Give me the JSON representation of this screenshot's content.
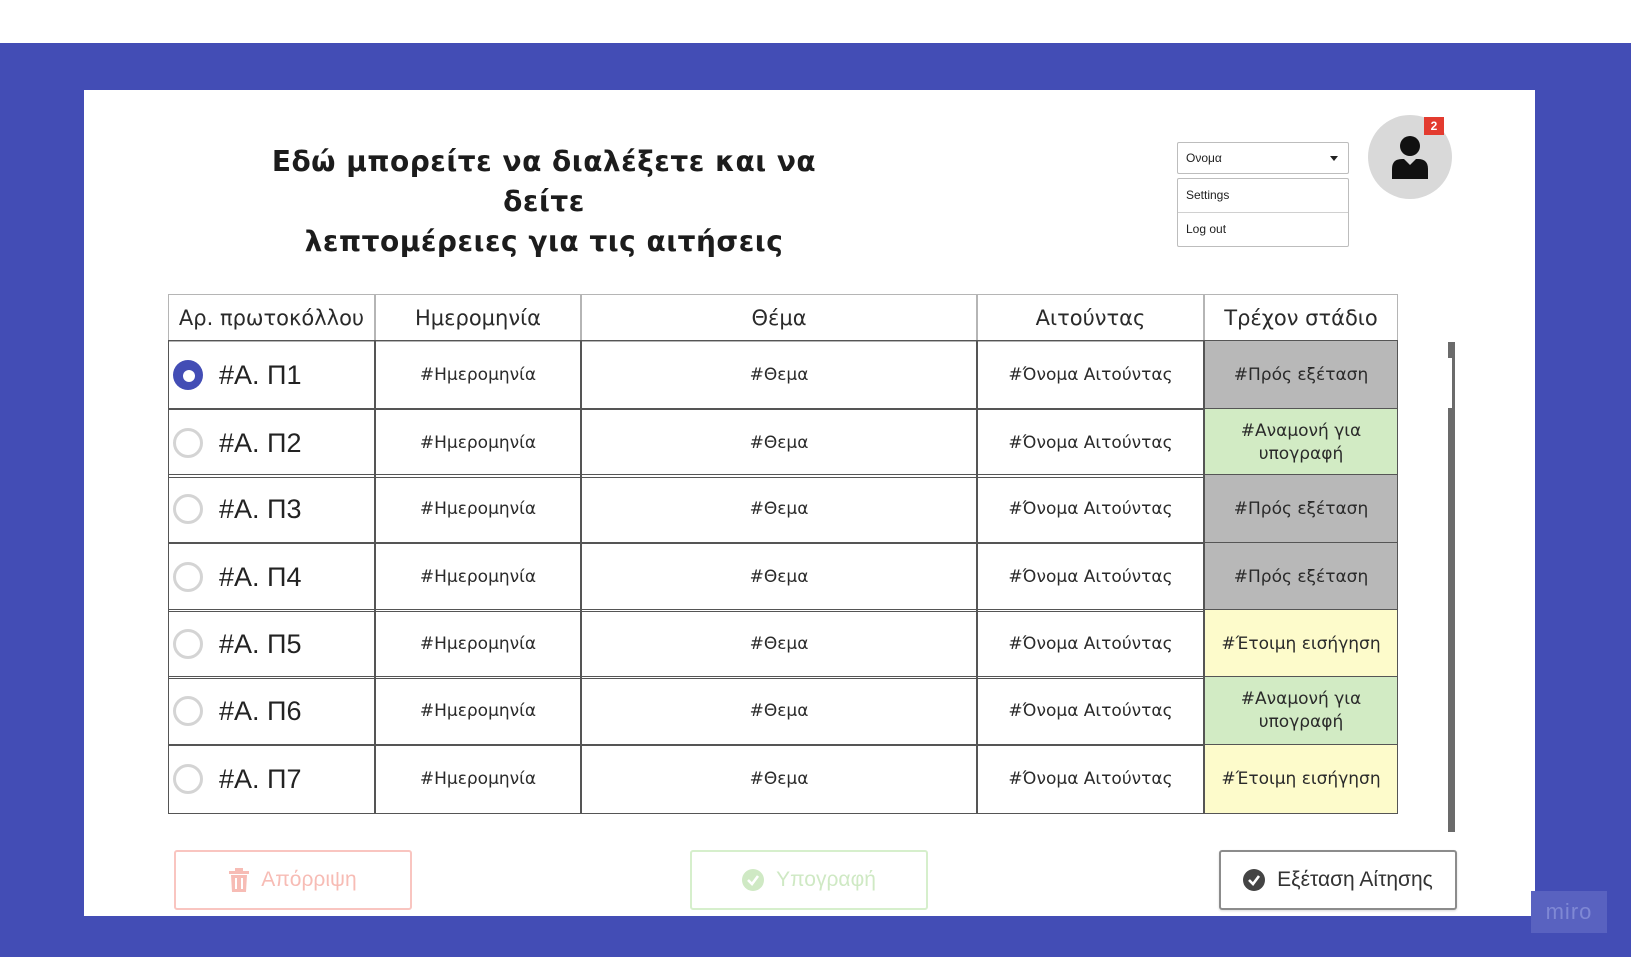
{
  "title": {
    "line1": "Εδώ μπορείτε να διαλέξετε και να δείτε",
    "line2": "λεπτομέρειες για τις αιτήσεις"
  },
  "user": {
    "select_value": "Ονομα",
    "menu": [
      "Settings",
      "Log out"
    ],
    "notification_count": "2"
  },
  "table": {
    "headers": [
      "Αρ. πρωτοκόλλου",
      "Ημερομηνία",
      "Θέμα",
      "Αιτούντας",
      "Τρέχον στάδιο"
    ],
    "rows": [
      {
        "id": "#Α. Π1",
        "date": "#Ημερομηνία",
        "subject": "#Θεμα",
        "applicant": "#Όνομα Αιτούντας",
        "stage": "#Πρός εξέταση",
        "stage_color": "#b8b8b8",
        "selected": true
      },
      {
        "id": "#Α. Π2",
        "date": "#Ημερομηνία",
        "subject": "#Θεμα",
        "applicant": "#Όνομα Αιτούντας",
        "stage": "#Αναμονή για υπογραφή",
        "stage_color": "#d2ebc4",
        "selected": false
      },
      {
        "id": "#Α. Π3",
        "date": "#Ημερομηνία",
        "subject": "#Θεμα",
        "applicant": "#Όνομα Αιτούντας",
        "stage": "#Πρός εξέταση",
        "stage_color": "#b8b8b8",
        "selected": false
      },
      {
        "id": "#Α. Π4",
        "date": "#Ημερομηνία",
        "subject": "#Θεμα",
        "applicant": "#Όνομα Αιτούντας",
        "stage": "#Πρός εξέταση",
        "stage_color": "#b8b8b8",
        "selected": false
      },
      {
        "id": "#Α. Π5",
        "date": "#Ημερομηνία",
        "subject": "#Θεμα",
        "applicant": "#Όνομα Αιτούντας",
        "stage": "#Έτοιμη εισήγηση",
        "stage_color": "#fdfbcb",
        "selected": false
      },
      {
        "id": "#Α. Π6",
        "date": "#Ημερομηνία",
        "subject": "#Θεμα",
        "applicant": "#Όνομα Αιτούντας",
        "stage": "#Αναμονή για υπογραφή",
        "stage_color": "#d2ebc4",
        "selected": false
      },
      {
        "id": "#Α. Π7",
        "date": "#Ημερομηνία",
        "subject": "#Θεμα",
        "applicant": "#Όνομα Αιτούντας",
        "stage": "#Έτοιμη εισήγηση",
        "stage_color": "#fdfbcb",
        "selected": false
      }
    ]
  },
  "actions": {
    "reject": "Απόρριψη",
    "sign": "Υπογραφή",
    "review": "Εξέταση Αίτησης"
  },
  "colors": {
    "accent": "#434db5",
    "reject": "#f7bcb5",
    "sign": "#cfe9c4"
  },
  "watermark": "miro"
}
